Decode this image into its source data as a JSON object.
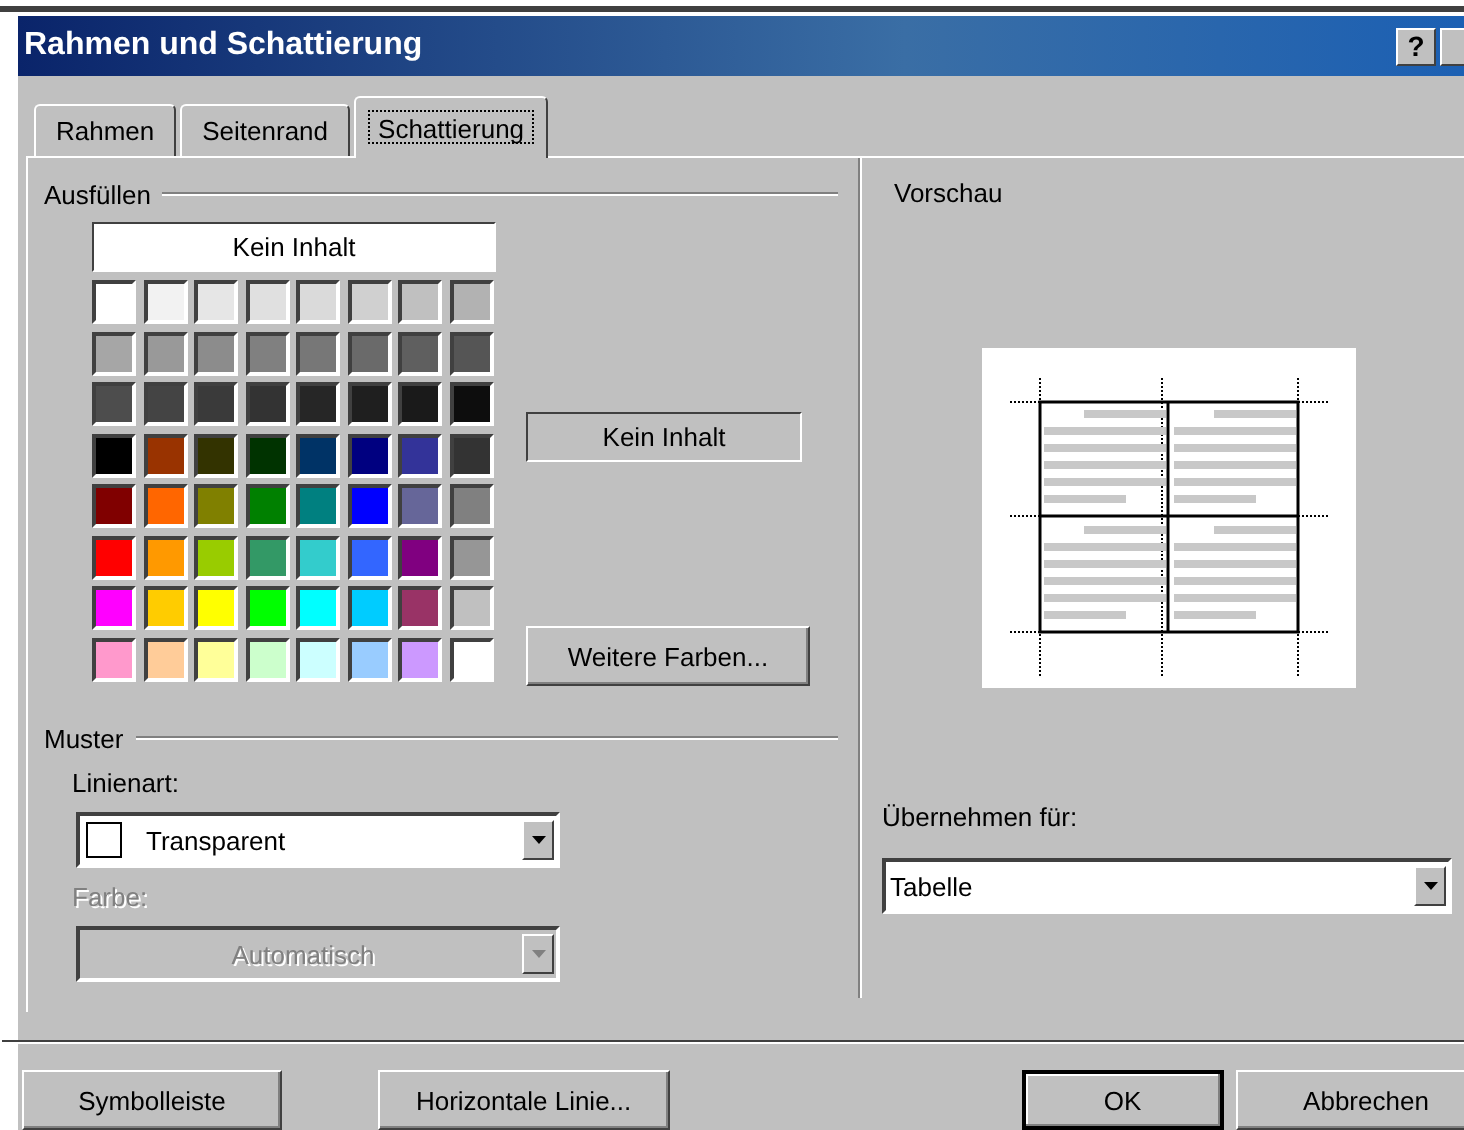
{
  "window": {
    "title": "Rahmen und Schattierung",
    "help": "?"
  },
  "tabs": [
    {
      "label": "Rahmen",
      "selected": false
    },
    {
      "label": "Seitenrand",
      "selected": false
    },
    {
      "label": "Schattierung",
      "selected": true
    }
  ],
  "fill": {
    "title": "Ausfüllen",
    "no_fill_button": "Kein Inhalt",
    "palette": [
      [
        {
          "color": "#ffffff"
        },
        {
          "color": "#f2f2f2"
        },
        {
          "color": "#e6e6e6"
        },
        {
          "color": "#e0e0e0"
        },
        {
          "color": "#dadada"
        },
        {
          "color": "#d0d0d0"
        },
        {
          "color": "#c0c0c0"
        },
        {
          "color": "#b2b2b2"
        }
      ],
      [
        {
          "color": "#a6a6a6"
        },
        {
          "color": "#999999"
        },
        {
          "color": "#8c8c8c"
        },
        {
          "color": "#808080"
        },
        {
          "color": "#777777"
        },
        {
          "color": "#6a6a6a"
        },
        {
          "color": "#5f5f5f"
        },
        {
          "color": "#555555"
        }
      ],
      [
        {
          "color": "#4d4d4d"
        },
        {
          "color": "#444444"
        },
        {
          "color": "#3a3a3a"
        },
        {
          "color": "#333333"
        },
        {
          "color": "#262626"
        },
        {
          "color": "#1f1f1f"
        },
        {
          "color": "#1a1a1a"
        },
        {
          "color": "#0d0d0d"
        }
      ],
      [
        {
          "color": "#000000"
        },
        {
          "color": "#993300"
        },
        {
          "color": "#333300"
        },
        {
          "color": "#003300"
        },
        {
          "color": "#003366"
        },
        {
          "color": "#000080"
        },
        {
          "color": "#333399"
        },
        {
          "color": "#333333"
        }
      ],
      [
        {
          "color": "#800000"
        },
        {
          "color": "#ff6600"
        },
        {
          "color": "#808000"
        },
        {
          "color": "#008000"
        },
        {
          "color": "#008080"
        },
        {
          "color": "#0000ff"
        },
        {
          "color": "#666699"
        },
        {
          "color": "#808080"
        }
      ],
      [
        {
          "color": "#ff0000"
        },
        {
          "color": "#ff9900"
        },
        {
          "color": "#99cc00"
        },
        {
          "color": "#339966"
        },
        {
          "color": "#33cccc"
        },
        {
          "color": "#3366ff"
        },
        {
          "color": "#800080"
        },
        {
          "color": "#969696"
        }
      ],
      [
        {
          "color": "#ff00ff"
        },
        {
          "color": "#ffcc00"
        },
        {
          "color": "#ffff00"
        },
        {
          "color": "#00ff00"
        },
        {
          "color": "#00ffff"
        },
        {
          "color": "#00ccff"
        },
        {
          "color": "#993366"
        },
        {
          "color": "#c0c0c0"
        }
      ],
      [
        {
          "color": "#ff99cc"
        },
        {
          "color": "#ffcc99"
        },
        {
          "color": "#ffff99"
        },
        {
          "color": "#ccffcc"
        },
        {
          "color": "#ccffff"
        },
        {
          "color": "#99ccff"
        },
        {
          "color": "#cc99ff"
        },
        {
          "color": "#ffffff"
        }
      ]
    ],
    "current": "Kein Inhalt",
    "more_colors_button": "Weitere Farben..."
  },
  "pattern": {
    "title": "Muster",
    "style": {
      "label": "Linienart:",
      "value": "Transparent",
      "disabled": false
    },
    "color": {
      "label": "Farbe:",
      "value": "Automatisch",
      "disabled": true
    }
  },
  "preview": {
    "title": "Vorschau",
    "apply_label": "Übernehmen für:",
    "apply_value": "Tabelle"
  },
  "buttons": [
    {
      "label": "Symbolleiste",
      "default": false
    },
    {
      "label": "Horizontale Linie...",
      "default": false
    },
    {
      "label": "OK",
      "default": true
    },
    {
      "label": "Abbrechen",
      "default": false
    }
  ]
}
